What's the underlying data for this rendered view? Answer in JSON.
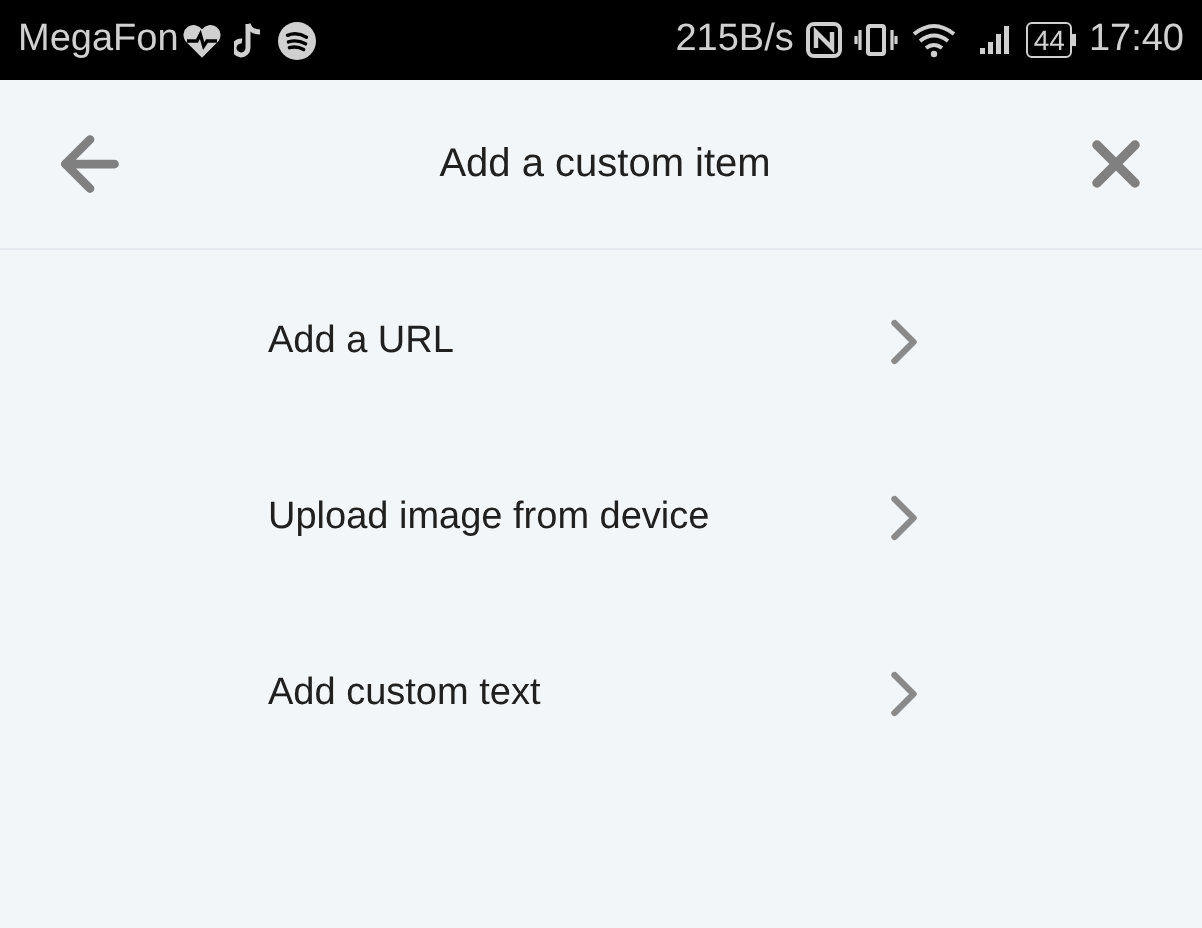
{
  "status_bar": {
    "carrier": "MegaFon",
    "speed": "215B/s",
    "battery": "44",
    "time": "17:40"
  },
  "header": {
    "title": "Add a custom item"
  },
  "items": [
    {
      "label": "Add a URL"
    },
    {
      "label": "Upload image from device"
    },
    {
      "label": "Add custom text"
    }
  ]
}
